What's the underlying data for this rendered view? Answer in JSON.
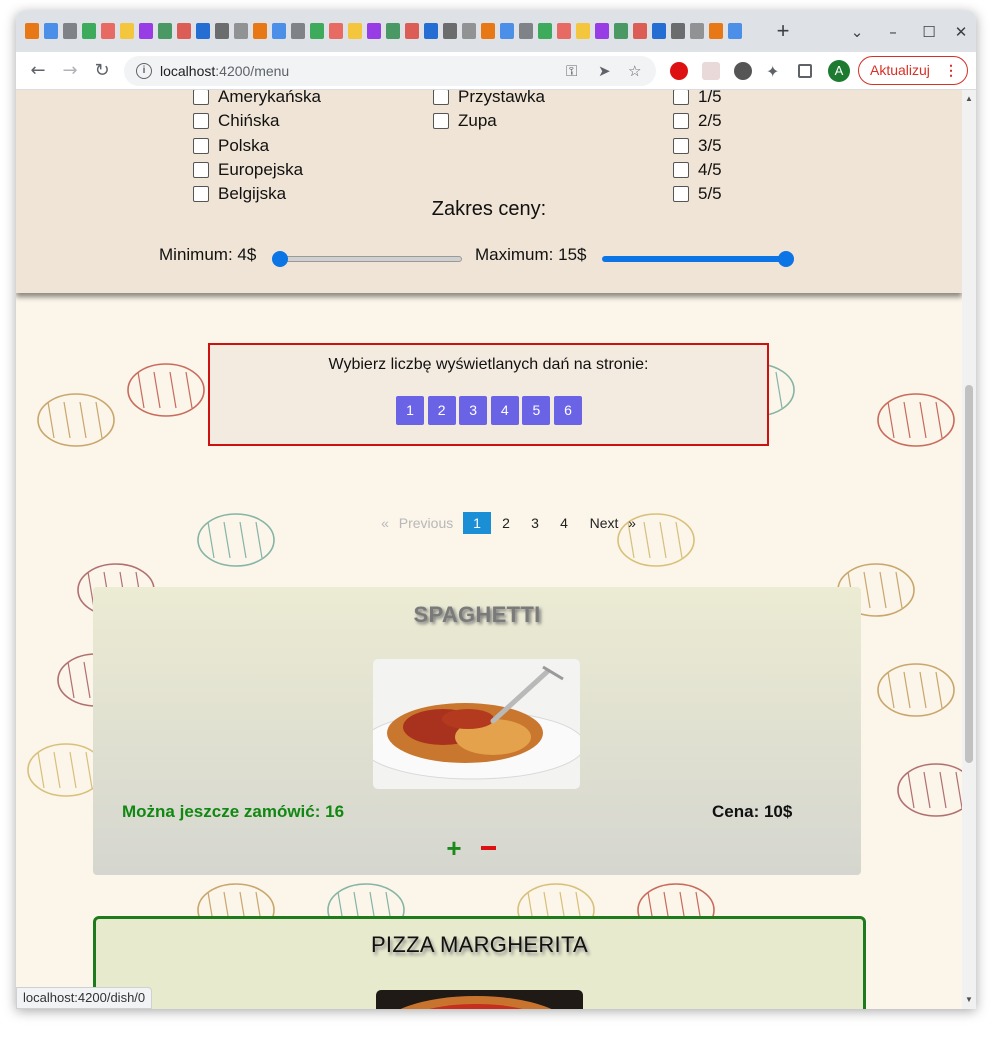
{
  "browser": {
    "new_tab_label": "+",
    "controls": {
      "tab_search": "⌄",
      "minimize": "–",
      "maximize": "☐",
      "close": "✕"
    },
    "nav": {
      "back": "←",
      "forward": "→",
      "reload": "↻"
    },
    "url_host": "localhost",
    "url_path": ":4200/menu",
    "avatar_letter": "A",
    "update_label": "Aktualizuj",
    "update_dots": "⋮",
    "status_url": "localhost:4200/dish/0"
  },
  "filters": {
    "cuisines": [
      "Amerykańska",
      "Chińska",
      "Polska",
      "Europejska",
      "Belgijska"
    ],
    "categories": [
      "Przystawka",
      "Zupa"
    ],
    "ratings": [
      "1/5",
      "2/5",
      "3/5",
      "4/5",
      "5/5"
    ],
    "price_title": "Zakres ceny:",
    "min_label": "Minimum: 4$",
    "max_label": "Maximum: 15$",
    "min_value": 4,
    "max_value": 15
  },
  "per_page": {
    "title": "Wybierz liczbę wyświetlanych dań na stronie:",
    "options": [
      "1",
      "2",
      "3",
      "4",
      "5",
      "6"
    ]
  },
  "pagination": {
    "prev_arrow": "«",
    "previous": "Previous",
    "pages": [
      "1",
      "2",
      "3",
      "4"
    ],
    "current": "1",
    "next": "Next",
    "next_arrow": "»"
  },
  "dishes": [
    {
      "name": "SPAGHETTI",
      "stock_label": "Można jeszcze zamówić: 16",
      "price_label": "Cena: 10$",
      "plus": "+"
    },
    {
      "name": "PIZZA MARGHERITA"
    }
  ],
  "colors": {
    "accent_blue": "#1a8fd6",
    "perpage_button": "#6b63e6",
    "stock_green": "#118811",
    "minus_red": "#dd1111",
    "panel_bg": "#efe4d5"
  }
}
